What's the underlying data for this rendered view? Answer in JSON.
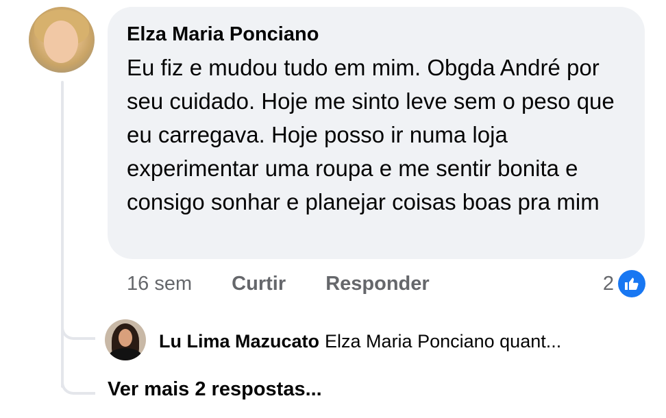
{
  "comment": {
    "author": "Elza Maria Ponciano",
    "text": "Eu fiz e mudou tudo em mim. Obgda André por seu cuidado. Hoje me sinto leve sem o peso que eu carregava. Hoje posso ir numa loja experimentar uma roupa e me sentir bonita e consigo sonhar e planejar coisas boas pra mim",
    "time": "16 sem",
    "like_label": "Curtir",
    "reply_label": "Responder",
    "reaction_count": "2",
    "reaction_icon": "like-icon",
    "reaction_color": "#1877f2"
  },
  "reply": {
    "author": "Lu Lima Mazucato",
    "preview": "Elza Maria Ponciano quant..."
  },
  "more_replies_label": "Ver mais 2 respostas..."
}
